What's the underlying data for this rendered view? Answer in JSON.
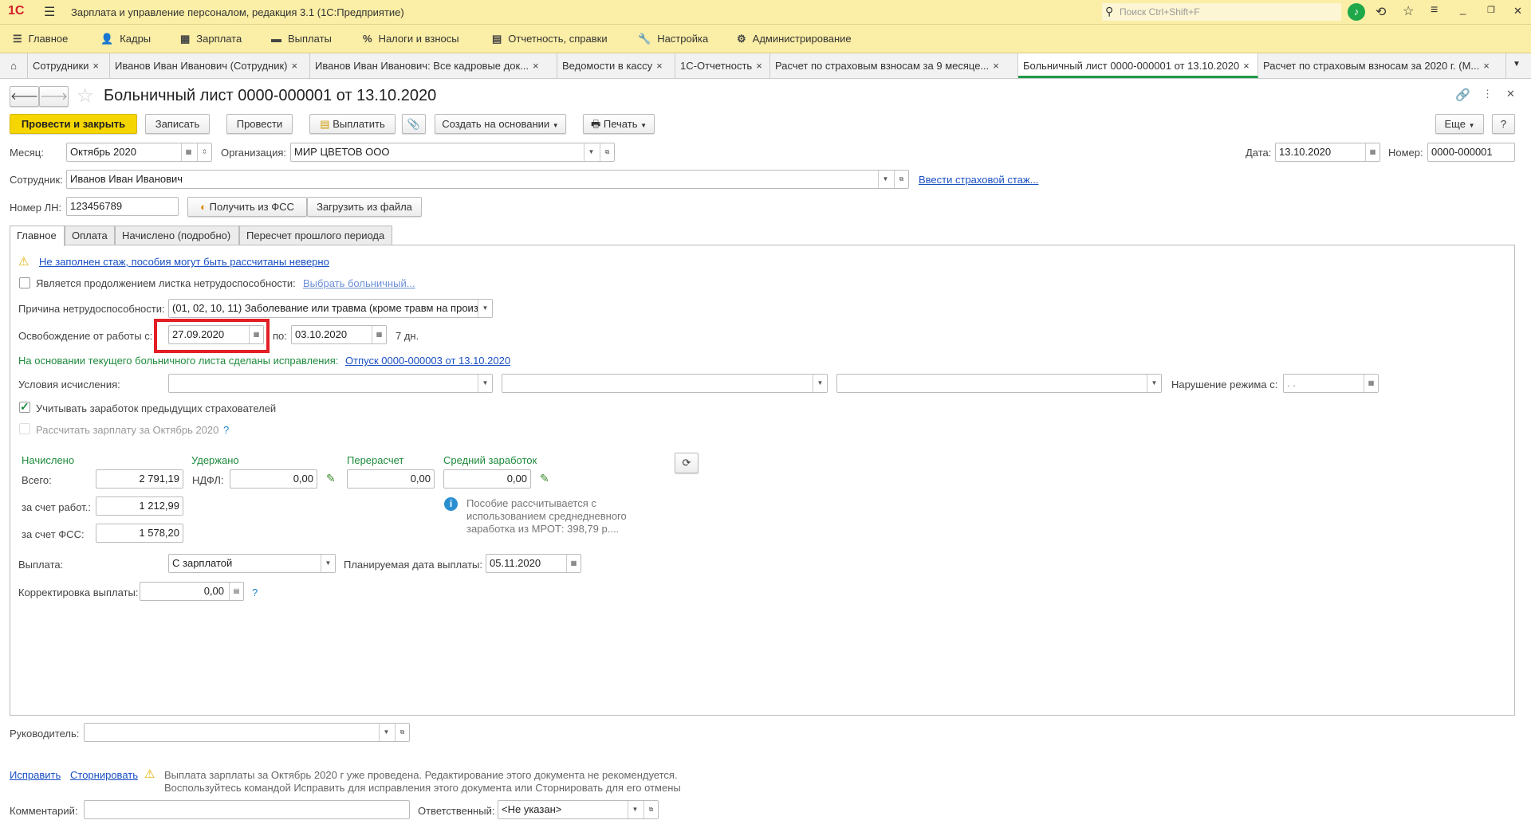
{
  "window": {
    "title": "Зарплата и управление персоналом, редакция 3.1  (1С:Предприятие)",
    "search_placeholder": "Поиск Ctrl+Shift+F"
  },
  "menu": [
    "Главное",
    "Кадры",
    "Зарплата",
    "Выплаты",
    "Налоги и взносы",
    "Отчетность, справки",
    "Настройка",
    "Администрирование"
  ],
  "open_tabs": [
    "Сотрудники",
    "Иванов Иван Иванович (Сотрудник)",
    "Иванов Иван Иванович: Все кадровые док...",
    "Ведомости в кассу",
    "1С-Отчетность",
    "Расчет по страховым взносам за 9 месяце...",
    "Больничный лист 0000-000001 от 13.10.2020",
    "Расчет по страховым взносам за 2020 г. (М..."
  ],
  "doc": {
    "title": "Больничный лист 0000-000001 от 13.10.2020"
  },
  "toolbar": {
    "post_close": "Провести и закрыть",
    "save": "Записать",
    "post": "Провести",
    "pay": "Выплатить",
    "create_based": "Создать на основании",
    "print": "Печать",
    "more": "Еще",
    "help": "?"
  },
  "header": {
    "month_label": "Месяц:",
    "month": "Октябрь 2020",
    "org_label": "Организация:",
    "org": "МИР ЦВЕТОВ ООО",
    "date_label": "Дата:",
    "date": "13.10.2020",
    "number_label": "Номер:",
    "number": "0000-000001",
    "employee_label": "Сотрудник:",
    "employee": "Иванов Иван Иванович",
    "insurance_link": "Ввести страховой стаж...",
    "ln_label": "Номер ЛН:",
    "ln": "123456789",
    "get_fss": "Получить из ФСС",
    "load_file": "Загрузить из файла"
  },
  "form_tabs": [
    "Главное",
    "Оплата",
    "Начислено (подробно)",
    "Пересчет прошлого периода"
  ],
  "main": {
    "warning_link": "Не заполнен стаж, пособия могут быть рассчитаны неверно",
    "continuation_label": "Является продолжением листка нетрудоспособности:",
    "continuation_link": "Выбрать больничный...",
    "reason_label": "Причина нетрудоспособности:",
    "reason": "(01, 02, 10, 11) Заболевание или травма (кроме травм на произв",
    "release_label": "Освобождение от работы с:",
    "release_from": "27.09.2020",
    "to_label": "по:",
    "release_to": "03.10.2020",
    "days": "7 дн.",
    "corrections_text": "На основании текущего больничного листа сделаны исправления:",
    "corrections_link": "Отпуск 0000-000003 от 13.10.2020",
    "conditions_label": "Условия исчисления:",
    "violation_label": "Нарушение режима с:",
    "violation_date": " .  .",
    "prev_insurers": "Учитывать заработок предыдущих страхователей",
    "prev_insurers_checked": true,
    "calc_salary": "Рассчитать зарплату за Октябрь 2020",
    "calc_salary_help": "?",
    "accrued_head": "Начислено",
    "withheld_head": "Удержано",
    "recalc_head": "Перерасчет",
    "avg_head": "Средний заработок",
    "total_label": "Всего:",
    "total": "2 791,19",
    "ndfl_label": "НДФЛ:",
    "ndfl": "0,00",
    "recalc": "0,00",
    "avg": "0,00",
    "employer_label": "за счет работ.:",
    "employer": "1 212,99",
    "fss_label": "за счет ФСС:",
    "fss": "1 578,20",
    "info_lines": [
      "Пособие рассчитывается с",
      "использованием среднедневного",
      "заработка из МРОТ: 398,79 р...."
    ],
    "payment_label": "Выплата:",
    "payment": "С зарплатой",
    "planned_label": "Планируемая дата выплаты:",
    "planned_date": "05.11.2020",
    "adjust_label": "Корректировка выплаты:",
    "adjust": "0,00",
    "adjust_help": "?"
  },
  "footer": {
    "manager_label": "Руководитель:",
    "fix": "Исправить",
    "storno": "Сторнировать",
    "warn_lines": [
      "Выплата зарплаты за Октябрь 2020 г уже проведена. Редактирование этого документа не рекомендуется.",
      "Воспользуйтесь командой Исправить для исправления этого документа или Сторнировать для его отмены"
    ],
    "comment_label": "Комментарий:",
    "responsible_label": "Ответственный:",
    "responsible": "<Не указан>"
  },
  "colors": {
    "accent_yellow": "#f6d600",
    "header_bg": "#fbeea6",
    "highlight": "#e31e24",
    "green": "#1e8a3c",
    "link": "#1a4fc4"
  }
}
